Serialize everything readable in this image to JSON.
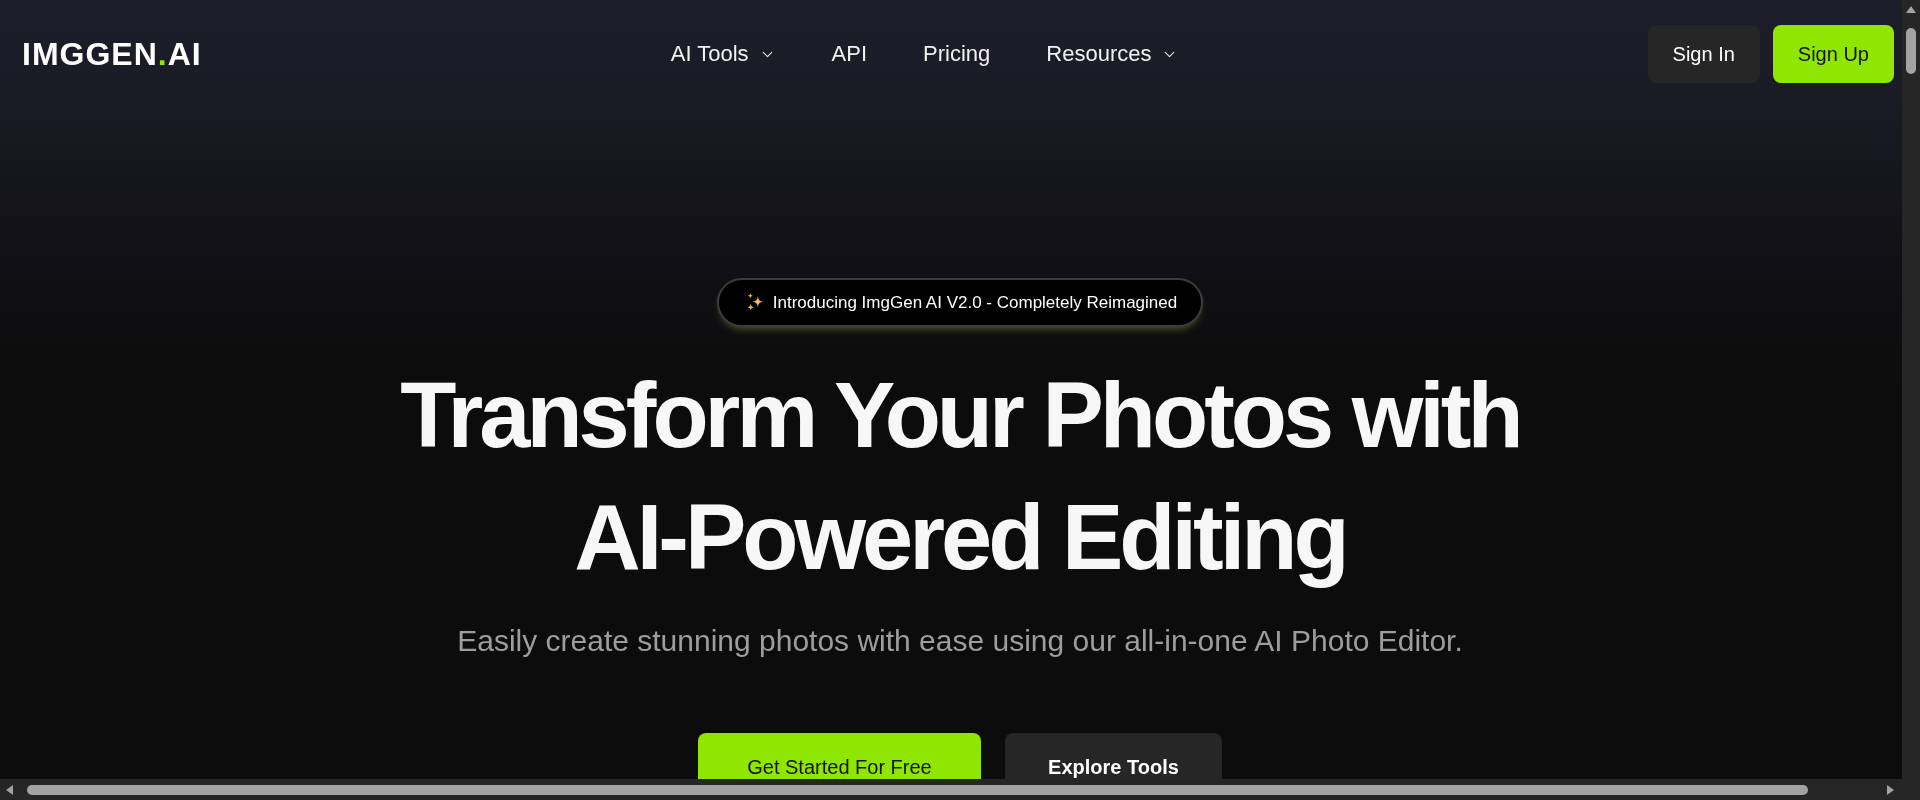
{
  "header": {
    "logo": {
      "name": "IMGGEN",
      "dot": ".",
      "suffix": "AI"
    },
    "nav": [
      {
        "label": "AI Tools",
        "kind": "dropdown"
      },
      {
        "label": "API",
        "kind": "link"
      },
      {
        "label": "Pricing",
        "kind": "link"
      },
      {
        "label": "Resources",
        "kind": "dropdown"
      }
    ],
    "actions": [
      {
        "label": "Sign In",
        "kind": "secondary"
      },
      {
        "label": "Sign Up",
        "kind": "primary"
      }
    ]
  },
  "hero": {
    "badge": "Introducing ImgGen AI V2.0 - Completely Reimagined",
    "title": "Transform Your Photos with AI-Powered Editing",
    "subtitle": "Easily create stunning photos with ease using our all-in-one AI Photo Editor.",
    "buttons": [
      {
        "label": "Get Started For Free",
        "kind": "primary"
      },
      {
        "label": "Explore Tools",
        "kind": "secondary"
      }
    ]
  }
}
